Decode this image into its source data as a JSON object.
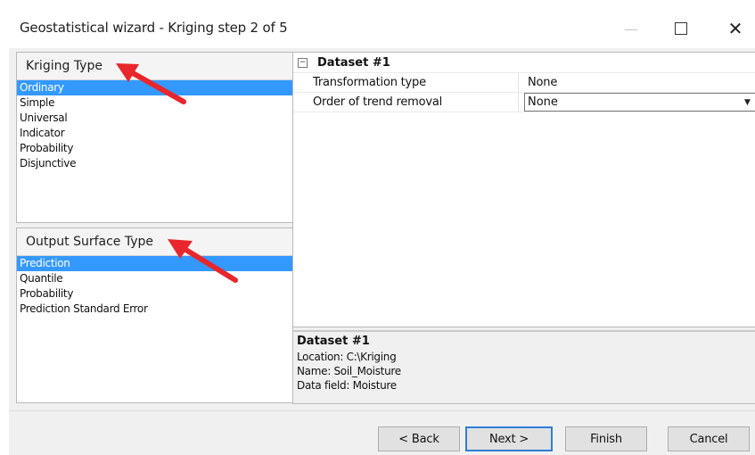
{
  "window": {
    "title": "Geostatistical wizard - Kriging step 2 of 5",
    "minimize_glyph": "—",
    "close_glyph": "✕"
  },
  "kriging_type": {
    "header": "Kriging Type",
    "items": [
      "Ordinary",
      "Simple",
      "Universal",
      "Indicator",
      "Probability",
      "Disjunctive"
    ],
    "selected": "Ordinary"
  },
  "output_surface_type": {
    "header": "Output Surface Type",
    "items": [
      "Prediction",
      "Quantile",
      "Probability",
      "Prediction Standard Error"
    ],
    "selected": "Prediction"
  },
  "properties": {
    "group_title": "Dataset #1",
    "collapse_glyph": "−",
    "rows": [
      {
        "name": "Transformation type",
        "value": "None"
      },
      {
        "name": "Order of trend removal",
        "value": "None"
      }
    ],
    "dropdown_glyph": "▼"
  },
  "info": {
    "title": "Dataset #1",
    "location": "Location: C:\\Kriging",
    "name": "Name: Soil_Moisture",
    "data_field": "Data field: Moisture"
  },
  "buttons": {
    "back": "< Back",
    "next": "Next >",
    "finish": "Finish",
    "cancel": "Cancel"
  },
  "colors": {
    "selection": "#3399ff",
    "annotation_arrow": "#e8262c",
    "primary_border": "#2f7ed8"
  }
}
